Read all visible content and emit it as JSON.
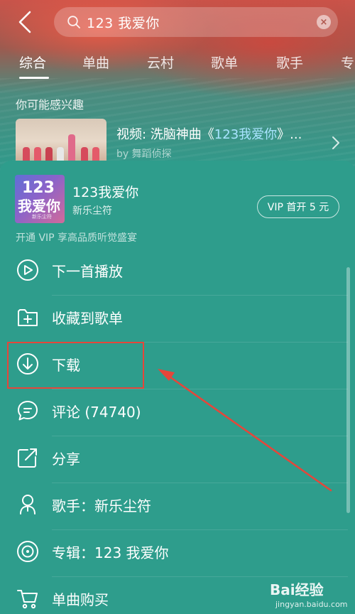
{
  "header": {
    "search_query": "123 我爱你"
  },
  "tabs": [
    {
      "label": "综合"
    },
    {
      "label": "单曲"
    },
    {
      "label": "云村"
    },
    {
      "label": "歌单"
    },
    {
      "label": "歌手"
    },
    {
      "label": "专"
    }
  ],
  "recommend": {
    "section_title": "你可能感兴趣",
    "video_prefix": "视频: 洗脑神曲《",
    "video_highlight": "123我爱你",
    "video_suffix": "》...",
    "author": "by 舞蹈侦探"
  },
  "sheet": {
    "cover_text_1": "123",
    "cover_text_2": "我爱你",
    "cover_text_3": "新乐尘符",
    "song_title": "123我爱你",
    "artist": "新乐尘符",
    "vip_button": "VIP 首开 5 元",
    "vip_hint": "开通 VIP 享高品质听觉盛宴",
    "menu": [
      {
        "label": "下一首播放",
        "icon": "play-next-icon"
      },
      {
        "label": "收藏到歌单",
        "icon": "add-to-playlist-icon"
      },
      {
        "label": "下载",
        "icon": "download-icon"
      },
      {
        "label": "评论 (74740)",
        "icon": "comment-icon"
      },
      {
        "label": "分享",
        "icon": "share-icon"
      },
      {
        "label": "歌手：新乐尘符",
        "icon": "singer-icon"
      },
      {
        "label": "专辑：123 我爱你",
        "icon": "album-icon"
      },
      {
        "label": "单曲购买",
        "icon": "cart-icon"
      }
    ]
  },
  "watermark": {
    "main": "Bai经验",
    "sub": "jingyan.baidu.com"
  },
  "colors": {
    "sheet_bg": "#2e9d8c",
    "highlight_box": "#e5463a",
    "highlight_text": "#a9e4ff"
  }
}
